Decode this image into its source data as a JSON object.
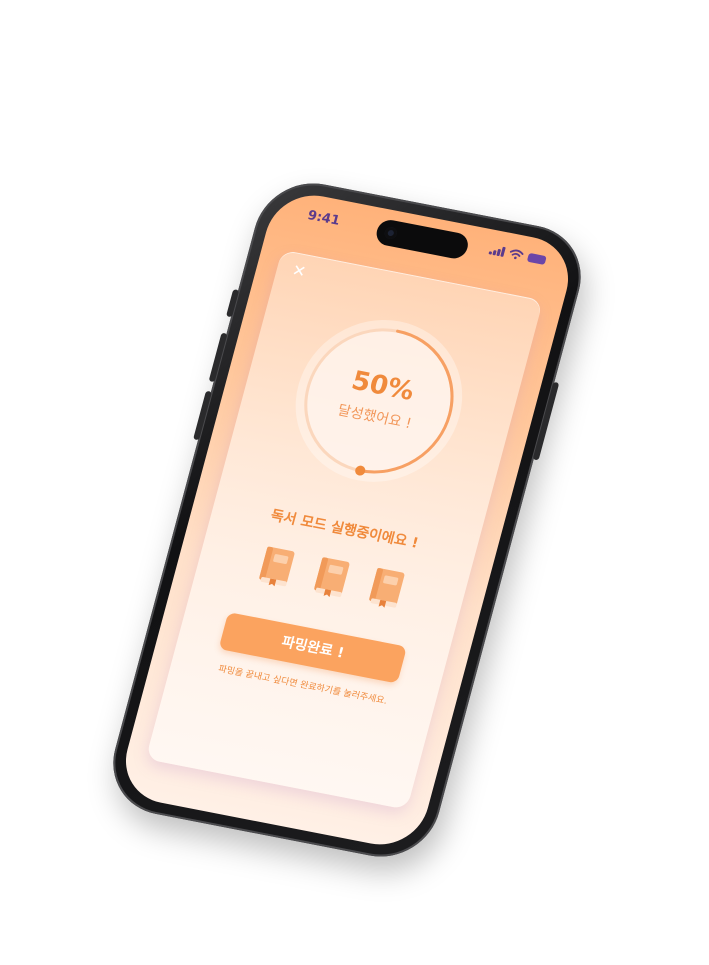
{
  "status_bar": {
    "time": "9:41"
  },
  "progress": {
    "percent_label": "50%",
    "percent_value": 50,
    "caption": "달성했어요 !"
  },
  "mode": {
    "message": "독서 모드 실행중이에요 !"
  },
  "books": [
    {
      "icon": "book-icon"
    },
    {
      "icon": "book-icon"
    },
    {
      "icon": "book-icon"
    }
  ],
  "action": {
    "complete_label": "파밍완료 !",
    "hint": "파밍을 끝내고 싶다면 완료하기를 눌러주세요."
  },
  "colors": {
    "accent": "#f08a3c",
    "button": "#fba35f",
    "status_purple": "#5b3b8c"
  },
  "icons": {
    "close": "close-icon",
    "signal": "signal-icon",
    "wifi": "wifi-icon",
    "battery": "battery-icon"
  }
}
